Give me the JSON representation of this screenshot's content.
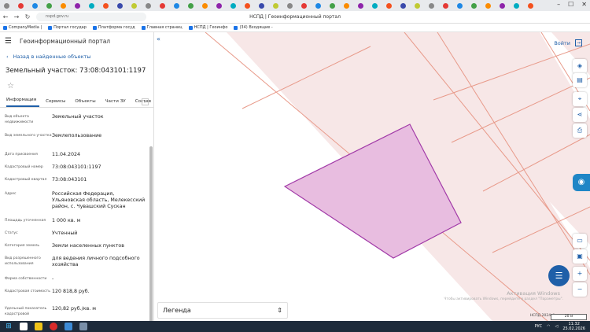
{
  "browser": {
    "page_title": "НСПД | Геоинформационный портал",
    "url": "nspd.gov.ru",
    "tab_count": 38,
    "bookmarks": [
      "CompanyMedia |",
      "Портал государ",
      "Платформа госуд",
      "Главная страниц",
      "НСПД | Геоинфо",
      "(34) Входящие -"
    ]
  },
  "panel": {
    "portal_name": "Геоинформационный портал",
    "back_link": "Назад в найденные объекты",
    "object_title": "Земельный участок: 73:08:043101:1197",
    "tabs": [
      "Информация",
      "Сервисы",
      "Объекты",
      "Части ЗУ",
      "Состав"
    ],
    "properties": [
      {
        "key": "Вид объекта недвижимости",
        "value": "Земельный участок"
      },
      {
        "key": "Вид земельного участка",
        "value": "Землепользование"
      },
      {
        "key": "Дата присвоения",
        "value": "11.04.2024"
      },
      {
        "key": "Кадастровый номер",
        "value": "73:08:043101:1197"
      },
      {
        "key": "Кадастровый квартал",
        "value": "73:08:043101"
      },
      {
        "key": "Адрес",
        "value": "Российская Федерация, Ульяновская область, Мелекесский район, с. Чувашский Сускан"
      },
      {
        "key": "Площадь уточненная",
        "value": "1 000 кв. м"
      },
      {
        "key": "Статус",
        "value": "Учтенный"
      },
      {
        "key": "Категория земель",
        "value": "Земли населенных пунктов"
      },
      {
        "key": "Вид разрешенного использования",
        "value": "для ведения личного подсобного хозяйства"
      },
      {
        "key": "Форма собственности",
        "value": "-"
      },
      {
        "key": "Кадастровая стоимость",
        "value": "120 818,8 руб."
      },
      {
        "key": "Удельный показатель кадастровой",
        "value": "120,82 руб./кв. м"
      }
    ]
  },
  "map": {
    "login_label": "Войти",
    "legend_label": "Легенда",
    "watermark_title": "Активация Windows",
    "watermark_text": "Чтобы активировать Windows, перейдите в раздел \"Параметры\".",
    "footer_text": "НСПД 2024 ©",
    "scale_label": "20 м",
    "parcel_color": "#e8bde0",
    "parcel_stroke": "#a23ba8",
    "line_color": "#e89a8a"
  },
  "taskbar": {
    "time": "11:32",
    "date": "25.02.2026",
    "lang": "РУС"
  }
}
